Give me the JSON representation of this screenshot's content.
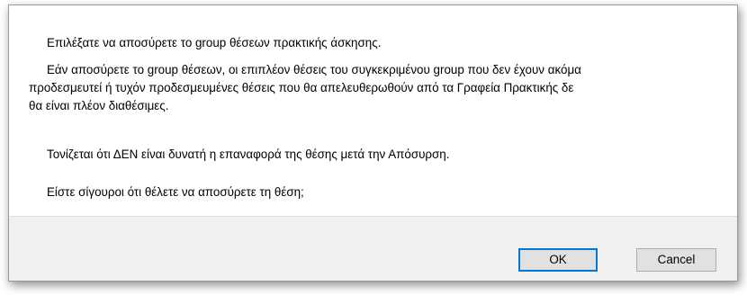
{
  "dialog": {
    "message_line1": "Επιλέξατε να αποσύρετε το group θέσεων πρακτικής άσκησης.",
    "message_line2a": "Εάν αποσύρετε το group θέσεων, οι επιπλέον θέσεις του συγκεκριμένου group που δεν έχουν ακόμα",
    "message_line2b": "προδεσμευτεί ή τυχόν προδεσμευμένες θέσεις που θα απελευθερωθούν από τα Γραφεία Πρακτικής δε",
    "message_line2c": "θα είναι πλέον διαθέσιμες.",
    "message_line3": "Τονίζεται ότι ΔΕΝ είναι δυνατή η επαναφορά της θέσης μετά την Απόσυρση.",
    "message_line4": "Είστε σίγουροι ότι θέλετε να αποσύρετε τη θέση;",
    "ok_label": "OK",
    "cancel_label": "Cancel"
  },
  "colors": {
    "focus_border": "#0078d7",
    "footer_bg": "#f0f0f0",
    "button_bg": "#e1e1e1"
  }
}
